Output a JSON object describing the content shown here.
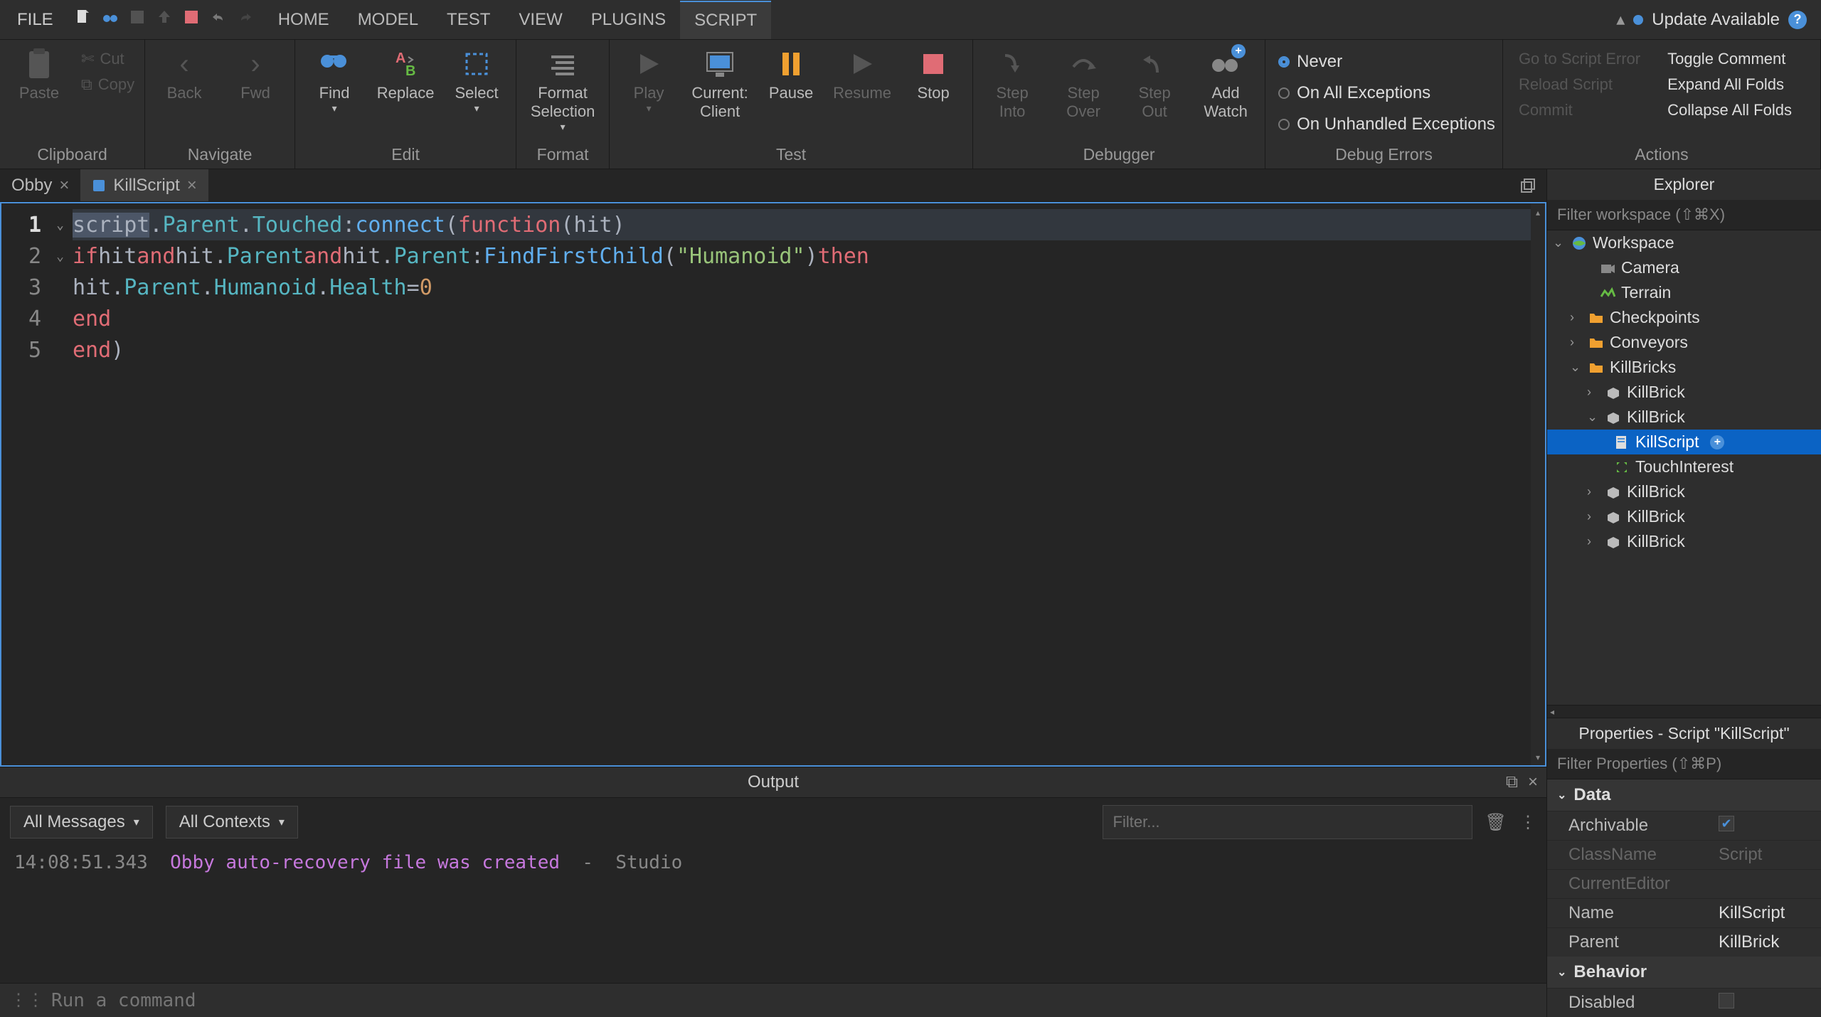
{
  "menu": {
    "file": "FILE",
    "tabs": [
      "HOME",
      "MODEL",
      "TEST",
      "VIEW",
      "PLUGINS",
      "SCRIPT"
    ],
    "active": 5,
    "update": "Update Available"
  },
  "ribbon": {
    "clipboard": {
      "title": "Clipboard",
      "paste": "Paste",
      "cut": "Cut",
      "copy": "Copy"
    },
    "navigate": {
      "title": "Navigate",
      "back": "Back",
      "fwd": "Fwd"
    },
    "edit": {
      "title": "Edit",
      "find": "Find",
      "replace": "Replace",
      "select": "Select"
    },
    "format": {
      "title": "Format",
      "format_selection": "Format\nSelection"
    },
    "test": {
      "title": "Test",
      "play": "Play",
      "current_client": "Current:\nClient",
      "pause": "Pause",
      "resume": "Resume",
      "stop": "Stop"
    },
    "debugger": {
      "title": "Debugger",
      "step_into": "Step\nInto",
      "step_over": "Step\nOver",
      "step_out": "Step\nOut",
      "add_watch": "Add\nWatch"
    },
    "debug_errors": {
      "title": "Debug Errors",
      "never": "Never",
      "all": "On All Exceptions",
      "unhandled": "On Unhandled Exceptions"
    },
    "actions": {
      "title": "Actions",
      "go_script": "Go to Script Error",
      "reload": "Reload Script",
      "commit": "Commit",
      "toggle_comment": "Toggle Comment",
      "expand": "Expand All Folds",
      "collapse": "Collapse All Folds"
    }
  },
  "tabs": {
    "items": [
      {
        "label": "Obby",
        "icon": "none",
        "active": false
      },
      {
        "label": "KillScript",
        "icon": "script",
        "active": true
      }
    ]
  },
  "code": {
    "lines": [
      1,
      2,
      3,
      4,
      5
    ]
  },
  "explorer": {
    "title": "Explorer",
    "filter_placeholder": "Filter workspace (⇧⌘X)",
    "tree": {
      "workspace": "Workspace",
      "camera": "Camera",
      "terrain": "Terrain",
      "checkpoints": "Checkpoints",
      "conveyors": "Conveyors",
      "killbricks": "KillBricks",
      "killbrick": "KillBrick",
      "killscript": "KillScript",
      "touchinterest": "TouchInterest"
    }
  },
  "properties": {
    "title": "Properties - Script \"KillScript\"",
    "filter_placeholder": "Filter Properties (⇧⌘P)",
    "sections": {
      "data": {
        "title": "Data",
        "archivable": "Archivable",
        "classname": "ClassName",
        "classname_val": "Script",
        "currenteditor": "CurrentEditor",
        "name": "Name",
        "name_val": "KillScript",
        "parent": "Parent",
        "parent_val": "KillBrick"
      },
      "behavior": {
        "title": "Behavior",
        "disabled": "Disabled"
      }
    }
  },
  "output": {
    "title": "Output",
    "messages_dd": "All Messages",
    "contexts_dd": "All Contexts",
    "filter_placeholder": "Filter...",
    "log_time": "14:08:51.343",
    "log_msg": "Obby auto-recovery file was created",
    "log_src": "Studio",
    "cmd_placeholder": "Run a command"
  }
}
